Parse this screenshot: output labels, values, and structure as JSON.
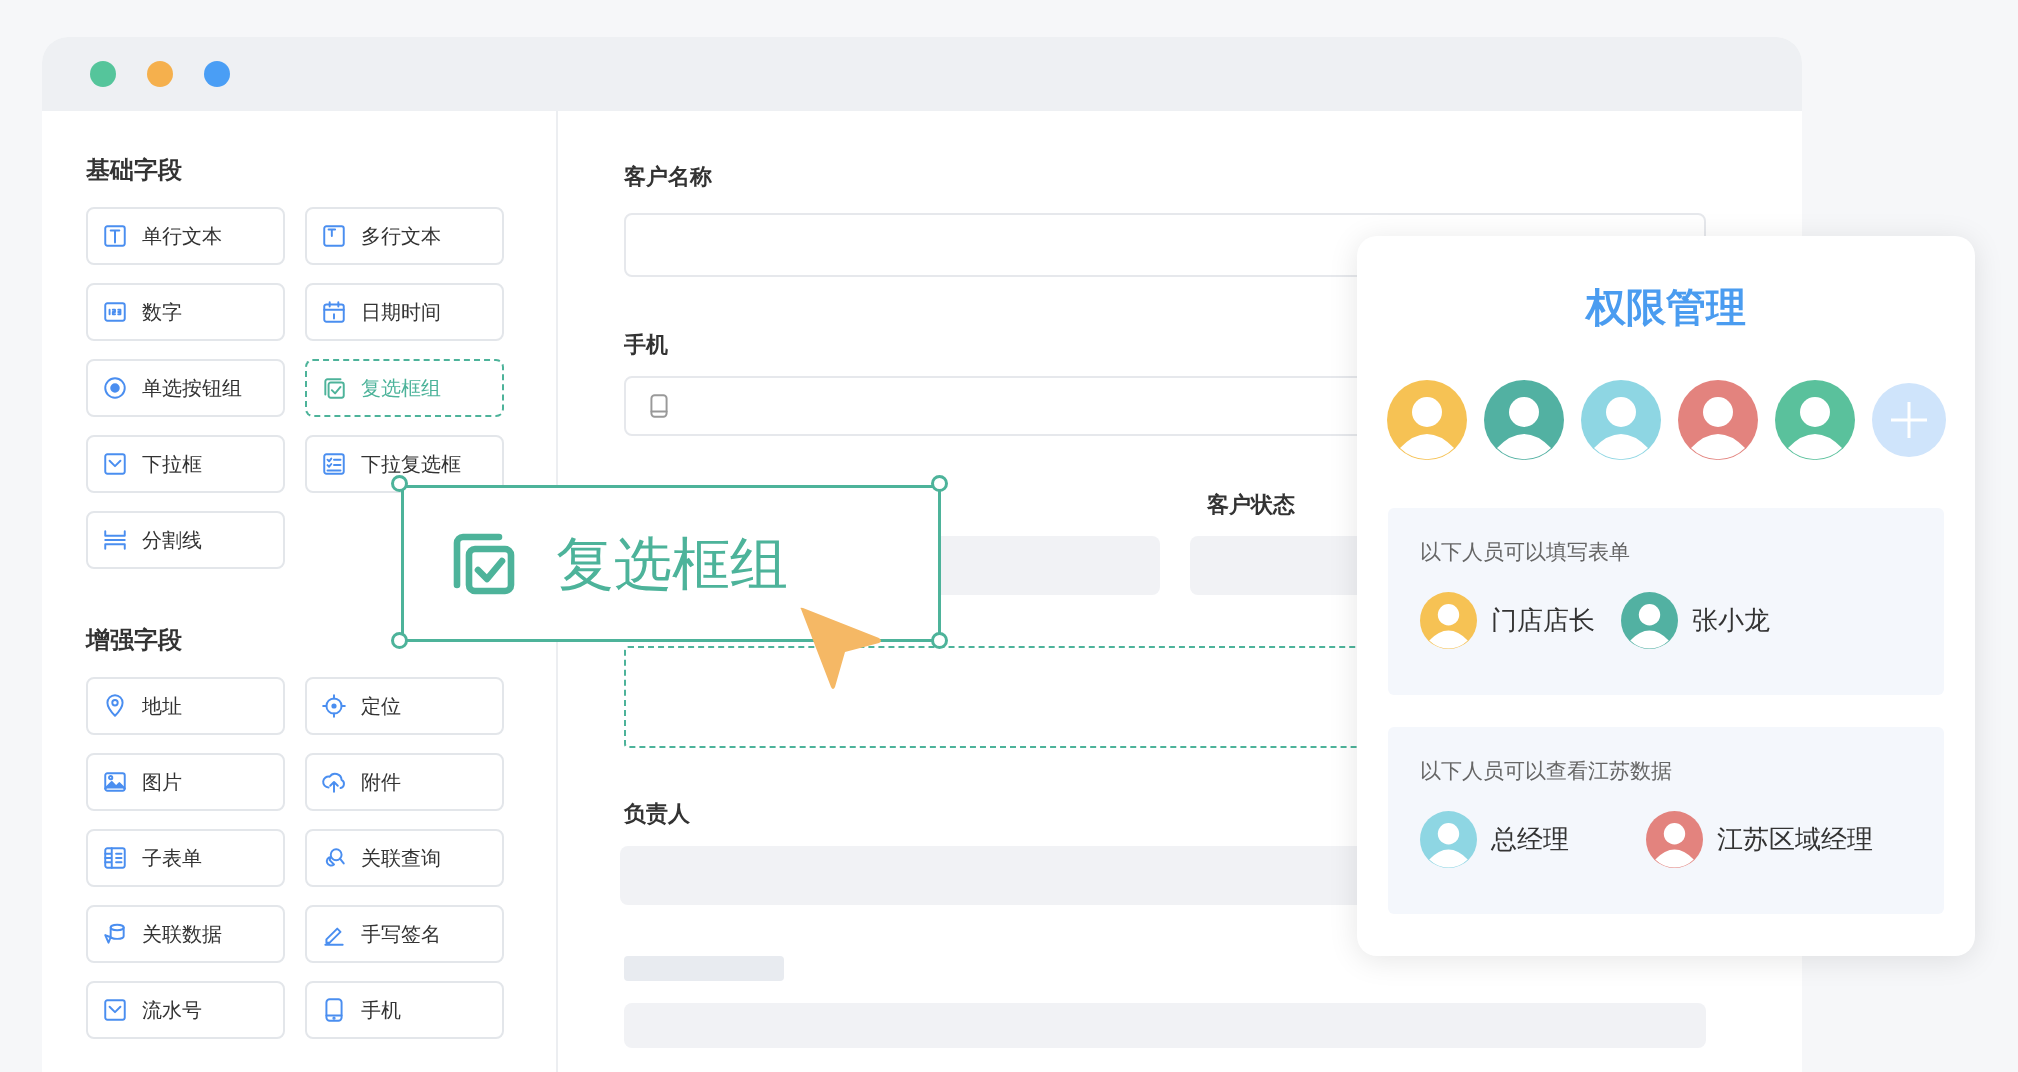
{
  "window": {
    "controls": [
      {
        "color": "#55c59b"
      },
      {
        "color": "#f5b04d"
      },
      {
        "color": "#4a9ef5"
      }
    ]
  },
  "sidebar": {
    "sections": [
      {
        "title": "基础字段",
        "items": [
          {
            "label": "单行文本",
            "selected": false
          },
          {
            "label": "多行文本",
            "selected": false
          },
          {
            "label": "数字",
            "selected": false
          },
          {
            "label": "日期时间",
            "selected": false
          },
          {
            "label": "单选按钮组",
            "selected": false
          },
          {
            "label": "复选框组",
            "selected": true
          },
          {
            "label": "下拉框",
            "selected": false
          },
          {
            "label": "下拉复选框",
            "selected": false
          },
          {
            "label": "分割线",
            "selected": false
          }
        ]
      },
      {
        "title": "增强字段",
        "items": [
          {
            "label": "地址",
            "selected": false
          },
          {
            "label": "定位",
            "selected": false
          },
          {
            "label": "图片",
            "selected": false
          },
          {
            "label": "附件",
            "selected": false
          },
          {
            "label": "子表单",
            "selected": false
          },
          {
            "label": "关联查询",
            "selected": false
          },
          {
            "label": "关联数据",
            "selected": false
          },
          {
            "label": "手写签名",
            "selected": false
          },
          {
            "label": "流水号",
            "selected": false
          },
          {
            "label": "手机",
            "selected": false
          }
        ]
      }
    ]
  },
  "form": {
    "fields": [
      {
        "kind": "input",
        "label": "客户名称"
      },
      {
        "kind": "phone",
        "label": "手机"
      },
      {
        "kind": "split",
        "label": "客户状态"
      },
      {
        "kind": "drop"
      },
      {
        "kind": "filled",
        "label": "负责人"
      },
      {
        "kind": "skeleton"
      }
    ]
  },
  "drag_ghost": {
    "label": "复选框组"
  },
  "permissions": {
    "title": "权限管理",
    "avatars": [
      {
        "color": "#f6c254"
      },
      {
        "color": "#52b1a2"
      },
      {
        "color": "#8ed6e3"
      },
      {
        "color": "#e3837e"
      },
      {
        "color": "#5ac19c"
      }
    ],
    "groups": [
      {
        "caption": "以下人员可以填写表单",
        "members": [
          {
            "name": "门店店长",
            "color": "#f6c254"
          },
          {
            "name": "张小龙",
            "color": "#52b1a2"
          }
        ]
      },
      {
        "caption": "以下人员可以查看江苏数据",
        "members": [
          {
            "name": "总经理",
            "color": "#8ed6e3"
          },
          {
            "name": "江苏区域经理",
            "color": "#e3837e"
          }
        ]
      }
    ]
  }
}
